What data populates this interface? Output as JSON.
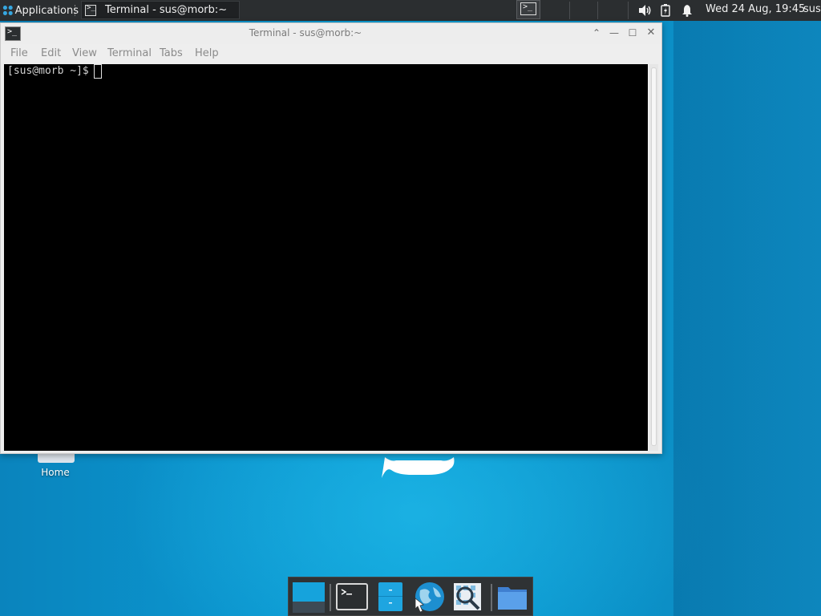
{
  "top_panel": {
    "applications_label": "Applications",
    "task_label": "Terminal - sus@morb:~",
    "term_glyph": ">_",
    "clock": "Wed 24 Aug, 19:45",
    "user": "sus",
    "icons": {
      "applications": "xfce-apps-icon",
      "workspace": "workspace-switcher-icon",
      "volume": "volume-icon",
      "battery": "battery-icon",
      "notifications": "bell-icon"
    }
  },
  "desktop": {
    "home_label": "Home"
  },
  "window": {
    "title": "Terminal - sus@morb:~",
    "icon_glyph": ">_",
    "menu": [
      "File",
      "Edit",
      "View",
      "Terminal",
      "Tabs",
      "Help"
    ],
    "controls": {
      "up": "⌃",
      "minimize": "—",
      "maximize": "☐",
      "close": "✕"
    },
    "terminal": {
      "prompt": "[sus@morb ~]$"
    }
  },
  "dock": {
    "items": [
      "show-desktop",
      "terminal",
      "file-manager",
      "web-browser",
      "app-finder",
      "home-folder"
    ]
  },
  "colors": {
    "panel_bg": "#2b2e30",
    "desktop_blue": "#0a9bd4",
    "terminal_bg": "#000000"
  }
}
